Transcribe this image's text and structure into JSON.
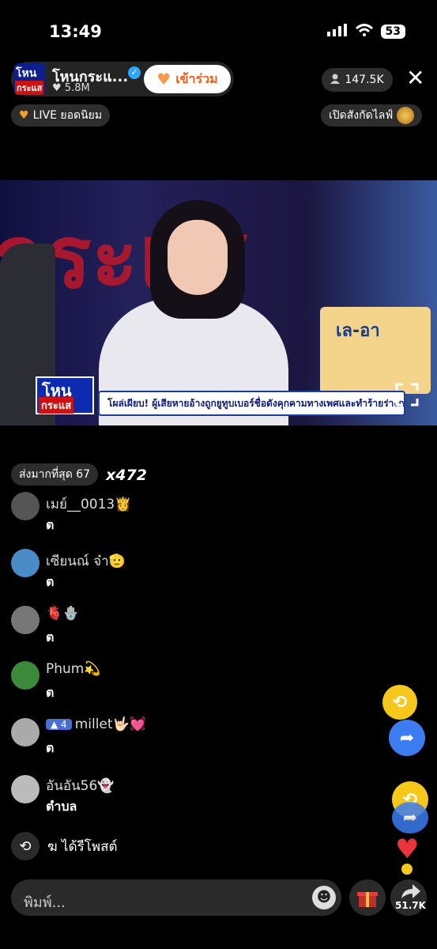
{
  "status": {
    "time": "13:49",
    "battery": "53"
  },
  "header": {
    "host_name": "โหนกระแ...",
    "host_likes": "5.8M",
    "join_label": "เข้าร่วม",
    "viewers": "147.5K",
    "live_label": "LIVE ยอดนิยม",
    "subscribe_label": "เปิดสังกัดไลฟ์",
    "avatar_line1": "โหน",
    "avatar_line2": "กระแส"
  },
  "video": {
    "ticker": "โผล่เผียบ! ผู้เสียหายอ้างถูกยูทูบเบอร์ชื่อดังคุกคามทางเพศและทำร้ายร่างกาย",
    "logo_line1": "โหน",
    "logo_line2": "กระแส",
    "product_text": "เล-อา",
    "bg_word": "กระแส"
  },
  "chat": {
    "top_sender": "ส่งมากที่สุด 67",
    "multiplier": "x472",
    "messages": [
      {
        "name": "เมย์__0013👸",
        "text": "ต",
        "avatar_color": "#555"
      },
      {
        "name": "เซียนณ์ จ๋า🫡",
        "text": "ต",
        "avatar_color": "#4a8cc8"
      },
      {
        "name": "🫀🪬",
        "text": "ต",
        "avatar_color": "#777"
      },
      {
        "name": "Phum💫",
        "text": "ต",
        "avatar_color": "#3a8a3a"
      },
      {
        "name": "millet🤟🏻💓",
        "level": "4",
        "text": "ต",
        "avatar_color": "#aaa"
      },
      {
        "name": "อันอัน56👻",
        "text": "ตำบล",
        "avatar_color": "#bbb"
      }
    ],
    "repost_text": "ฆ ได้รีโพสต์"
  },
  "bottom": {
    "input_placeholder": "พิมพ์...",
    "share_count": "51.7K"
  },
  "colors": {
    "accent_orange": "#f05a1a",
    "fab_yellow": "#f7c81c",
    "fab_blue": "#3b7cf0",
    "heart_red": "#e8343a"
  }
}
